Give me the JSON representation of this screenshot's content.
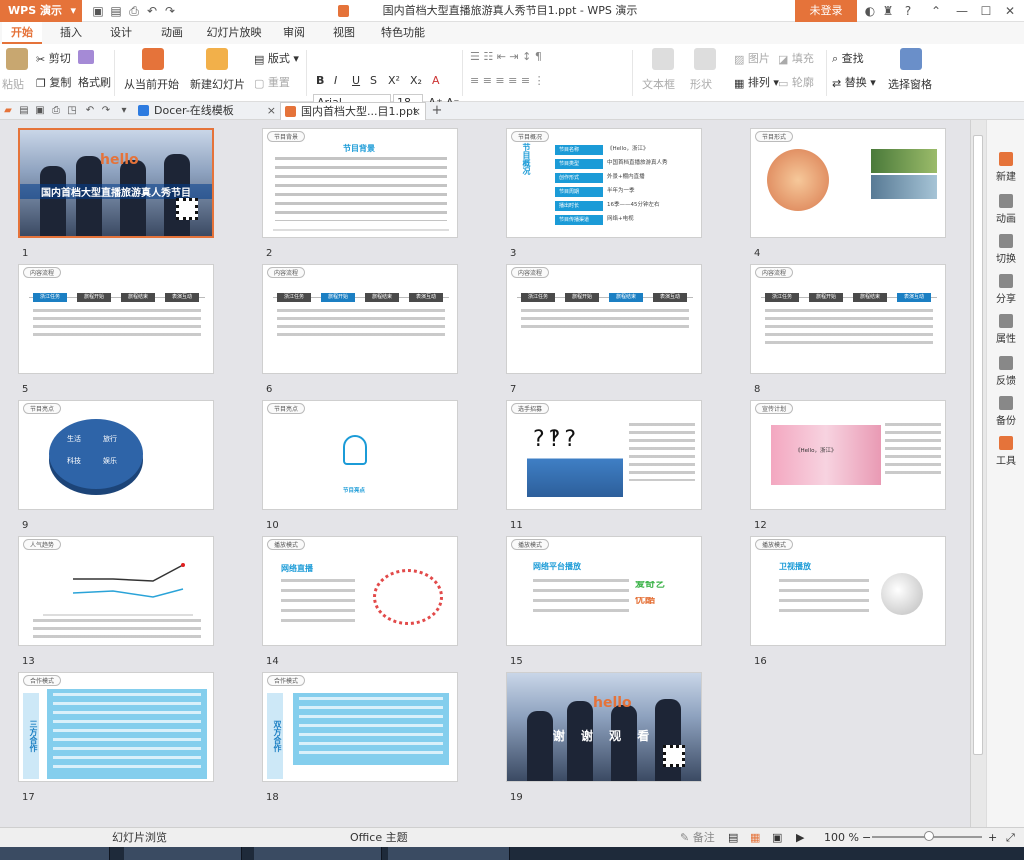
{
  "titlebar": {
    "app_menu": "WPS 演示",
    "document_title": "国内首档大型直播旅游真人秀节目1.ppt - WPS 演示",
    "login_label": "未登录",
    "help_label": "?"
  },
  "ribbon_tabs": [
    "开始",
    "插入",
    "设计",
    "动画",
    "幻灯片放映",
    "审阅",
    "视图",
    "特色功能"
  ],
  "ribbon": {
    "paste": "粘贴",
    "cut": "剪切",
    "copy": "复制",
    "format_painter": "格式刷",
    "from_current": "从当前开始",
    "new_slide": "新建幻灯片",
    "layout": "版式",
    "reset": "重置",
    "font": "Arial",
    "font_size": "18",
    "text_box": "文本框",
    "shape": "形状",
    "picture": "图片",
    "fill": "填充",
    "arrange": "排列",
    "outline": "轮廓",
    "find": "查找",
    "replace": "替换",
    "select_pane": "选择窗格"
  },
  "doc_tabs": [
    {
      "label": "Docer-在线模板",
      "active": false
    },
    {
      "label": "国内首档大型...目1.ppt",
      "active": true
    }
  ],
  "slides": [
    {
      "num": "1",
      "title": "国内首档大型直播旅游真人秀节目",
      "logo": "hello"
    },
    {
      "num": "2",
      "tag": "节目背景",
      "heading": "节目背景"
    },
    {
      "num": "3",
      "tag": "节目概况",
      "heading": "节目概况",
      "items": [
        "节目名称",
        "节目类型",
        "创作形式",
        "节目周期",
        "播出时长",
        "节目传播渠道"
      ],
      "values": [
        "《Hello，浙江》",
        "中国首档直播旅游真人秀",
        "外景+棚内直播",
        "半年为一季",
        "16季——45分钟左右",
        "网络+电视"
      ]
    },
    {
      "num": "4",
      "tag": "节目形式"
    },
    {
      "num": "5",
      "tag": "内容流程",
      "steps": [
        "浙江任务",
        "旅程开始",
        "旅程结束",
        "表演互动"
      ]
    },
    {
      "num": "6",
      "tag": "内容流程",
      "steps": [
        "浙江任务",
        "旅程开始",
        "旅程结束",
        "表演互动"
      ]
    },
    {
      "num": "7",
      "tag": "内容流程",
      "steps": [
        "浙江任务",
        "旅程开始",
        "旅程结束",
        "表演互动"
      ]
    },
    {
      "num": "8",
      "tag": "内容流程",
      "steps": [
        "浙江任务",
        "旅程开始",
        "旅程结束",
        "表演互动"
      ]
    },
    {
      "num": "9",
      "tag": "节目亮点",
      "segments": [
        "生活",
        "旅行",
        "科技",
        "娱乐"
      ]
    },
    {
      "num": "10",
      "tag": "节目亮点",
      "center": "节目亮点"
    },
    {
      "num": "11",
      "tag": "选手招募"
    },
    {
      "num": "12",
      "tag": "宣传计划",
      "banner": "《Hello，浙江》"
    },
    {
      "num": "13",
      "tag": "人气趋势"
    },
    {
      "num": "14",
      "tag": "播放模式",
      "heading": "网络直播"
    },
    {
      "num": "15",
      "tag": "播放模式",
      "heading": "网络平台播放",
      "brand1": "爱奇艺",
      "brand2": "优酷"
    },
    {
      "num": "16",
      "tag": "播放模式",
      "heading": "卫视播放"
    },
    {
      "num": "17",
      "tag": "合作模式",
      "vertical": "三方合作"
    },
    {
      "num": "18",
      "tag": "合作模式",
      "vertical": "双方合作"
    },
    {
      "num": "19",
      "title": "谢 谢 观 看",
      "logo": "hello"
    }
  ],
  "right_sidebar": [
    "新建",
    "动画",
    "切换",
    "分享",
    "属性",
    "反馈",
    "备份",
    "工具"
  ],
  "statusbar": {
    "view_label": "幻灯片浏览",
    "theme_label": "Office 主题",
    "notes_label": "备注",
    "zoom": "100 %"
  },
  "colors": {
    "accent": "#e5733a",
    "slide_blue": "#1b9bd7"
  }
}
